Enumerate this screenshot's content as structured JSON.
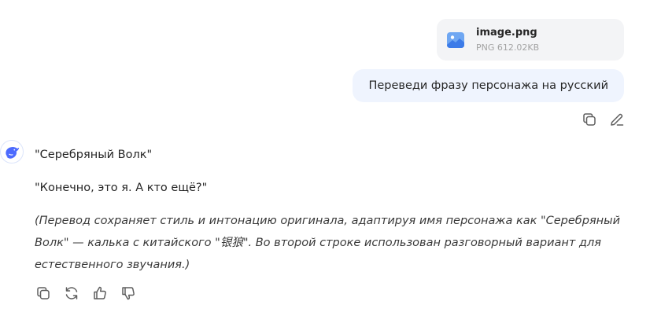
{
  "attachment": {
    "file_name": "image.png",
    "file_meta": "PNG 612.02KB",
    "icon": "image-file-icon"
  },
  "user_message": {
    "text": "Переведи фразу персонажа на русский"
  },
  "user_actions": [
    "copy-icon",
    "edit-icon"
  ],
  "assistant": {
    "avatar_icon": "whale-logo-icon",
    "lines": [
      "\"Серебряный Волк\"",
      "\"Конечно, это я. А кто ещё?\"",
      "(Перевод сохраняет стиль и интонацию оригинала, адаптируя имя персонажа как \"Серебряный Волк\" — калька с китайского \"银狼\". Во второй строке использован разговорный вариант для естественного звучания.)"
    ]
  },
  "assistant_actions": [
    "copy-icon",
    "regenerate-icon",
    "thumbs-up-icon",
    "thumbs-down-icon"
  ],
  "colors": {
    "user_bubble": "#eff4fe",
    "file_card": "#f3f4f6",
    "icon": "#5e5e5e",
    "accent": "#4d6bfe"
  }
}
